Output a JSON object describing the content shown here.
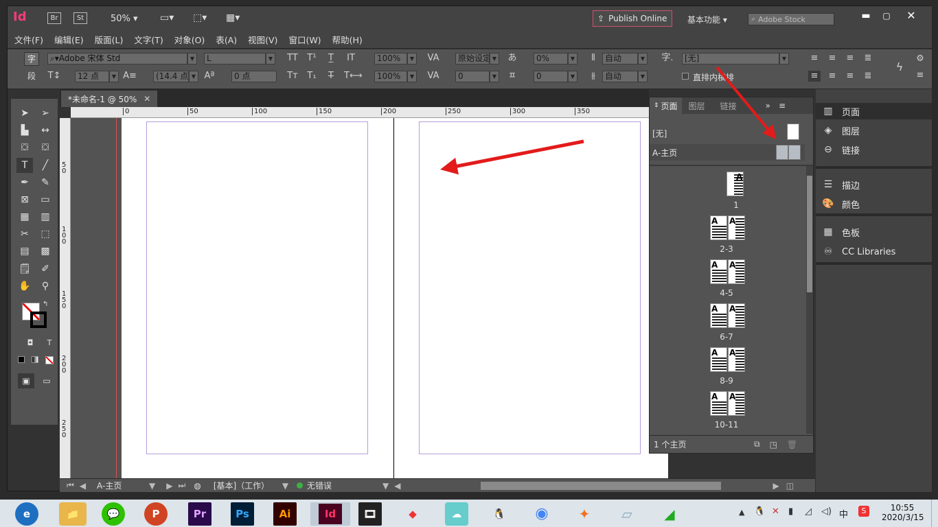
{
  "window": {
    "app_icon": "Id",
    "bridge": "Br",
    "stock": "St",
    "zoom": "50%",
    "publish_label": "Publish Online",
    "workspace": "基本功能",
    "stock_search_placeholder": "Adobe Stock"
  },
  "menu": [
    "文件(F)",
    "编辑(E)",
    "版面(L)",
    "文字(T)",
    "对象(O)",
    "表(A)",
    "视图(V)",
    "窗口(W)",
    "帮助(H)"
  ],
  "control": {
    "mode_char": "字",
    "mode_para": "段",
    "font_family": "Adobe 宋体 Std",
    "font_style": "L",
    "font_size": "12 点",
    "leading": "(14.4 点",
    "baseline": "0 点",
    "vscale": "100%",
    "hscale": "100%",
    "kerning": "原始设定",
    "tracking": "0",
    "skew": "0%",
    "skew2": "0",
    "auto1": "自动",
    "auto2": "自动",
    "style_label": "字.",
    "para_style": "[无]",
    "vertical_label": "直排内横排"
  },
  "doc_tab": {
    "title": "*未命名-1 @ 50%"
  },
  "ruler": {
    "h_ticks": [
      "0",
      "50",
      "100",
      "150",
      "200",
      "250",
      "300",
      "350"
    ],
    "v_ticks": [
      "5\n0",
      "1\n0\n0",
      "1\n5\n0",
      "2\n0\n0",
      "2\n5\n0"
    ]
  },
  "pages_panel": {
    "tabs": [
      "页面",
      "图层",
      "链接"
    ],
    "masters": [
      {
        "name": "[无]"
      },
      {
        "name": "A-主页"
      }
    ],
    "pages": [
      {
        "label": "1"
      },
      {
        "label": "2-3"
      },
      {
        "label": "4-5"
      },
      {
        "label": "6-7"
      },
      {
        "label": "8-9"
      },
      {
        "label": "10-11"
      }
    ],
    "footer": "1 个主页"
  },
  "dock": {
    "groups": [
      [
        "页面",
        "图层",
        "链接"
      ],
      [
        "描边",
        "颜色"
      ],
      [
        "色板",
        "CC Libraries"
      ]
    ]
  },
  "status": {
    "page": "A-主页",
    "preflight_profile": "[基本]（工作）",
    "errors": "无错误"
  },
  "taskbar": {
    "time": "10:55",
    "date": "2020/3/15",
    "ime": "中",
    "apps": [
      {
        "icon": "e",
        "color": "#1f6fc0"
      },
      {
        "icon": "📁",
        "color": "#e8b64a"
      },
      {
        "icon": "💬",
        "color": "#2dc100"
      },
      {
        "icon": "P",
        "color": "#d04423"
      },
      {
        "icon": "Pr",
        "color": "#2a0a4a"
      },
      {
        "icon": "Ps",
        "color": "#001e36"
      },
      {
        "icon": "Ai",
        "color": "#330000"
      },
      {
        "icon": "Id",
        "color": "#49021f"
      },
      {
        "icon": "🎞",
        "color": "#222"
      },
      {
        "icon": "◆",
        "color": "#e33"
      },
      {
        "icon": "☁",
        "color": "#6cc"
      },
      {
        "icon": "🐧",
        "color": "#000"
      },
      {
        "icon": "◉",
        "color": "#4285f4"
      },
      {
        "icon": "✦",
        "color": "#f07020"
      },
      {
        "icon": "▱",
        "color": "#8ab"
      },
      {
        "icon": "◢",
        "color": "#2a2"
      }
    ]
  },
  "colors": {
    "accent_red": "#e31b1b",
    "indesign_pink": "#ff3366",
    "margin_guide": "#b39ddb"
  }
}
